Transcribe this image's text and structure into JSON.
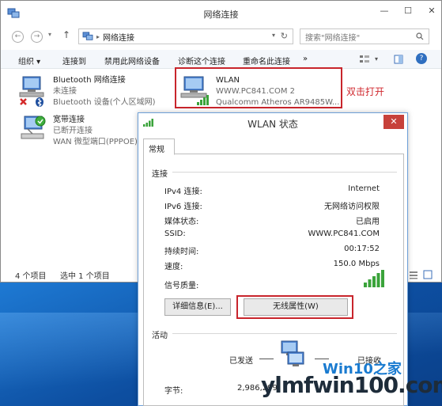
{
  "explorer": {
    "title": "网络连接",
    "address": {
      "crumb_sep": "▸",
      "crumb": "网络连接",
      "chevron": "▾",
      "refresh": "↻"
    },
    "search": {
      "placeholder": "搜索\"网络连接\""
    },
    "toolbar": {
      "organize": "组织 ▾",
      "connect_to": "连接到",
      "disable_device": "禁用此网络设备",
      "diagnose": "诊断这个连接",
      "rename": "重命名此连接",
      "more": "»"
    },
    "connections": [
      {
        "name": "Bluetooth 网络连接",
        "status": "未连接",
        "device": "Bluetooth 设备(个人区域网)"
      },
      {
        "name": "WLAN",
        "status": "WWW.PC841.COM  2",
        "device": "Qualcomm Atheros AR9485W..."
      },
      {
        "name": "宽带连接",
        "status": "已断开连接",
        "device": "WAN 微型端口(PPPOE)"
      }
    ],
    "statusbar": {
      "count": "4 个项目",
      "selected": "选中 1 个项目"
    },
    "annotation": "双击打开"
  },
  "dialog": {
    "title": "WLAN 状态",
    "close": "✕",
    "tab": "常规",
    "connection_group": "连接",
    "rows": [
      {
        "label": "IPv4 连接:",
        "value": "Internet"
      },
      {
        "label": "IPv6 连接:",
        "value": "无网络访问权限"
      },
      {
        "label": "媒体状态:",
        "value": "已启用"
      },
      {
        "label": "SSID:",
        "value": "WWW.PC841.COM"
      },
      {
        "label": "持续时间:",
        "value": "00:17:52"
      },
      {
        "label": "速度:",
        "value": "150.0 Mbps"
      },
      {
        "label": "信号质量:",
        "value": ""
      }
    ],
    "details_button": "详细信息(E)...",
    "wireless_button": "无线属性(W)",
    "activity_group": "活动",
    "sent_label": "已发送",
    "received_label": "已接收",
    "bytes_label": "字节:",
    "bytes_sent": "2,986,299"
  },
  "watermark": {
    "main": "ylmfwin100.com",
    "sub": "Win10之家"
  },
  "colors": {
    "accent_red": "#c8252c",
    "close_red": "#c7413a",
    "signal_green": "#3aa33a"
  }
}
